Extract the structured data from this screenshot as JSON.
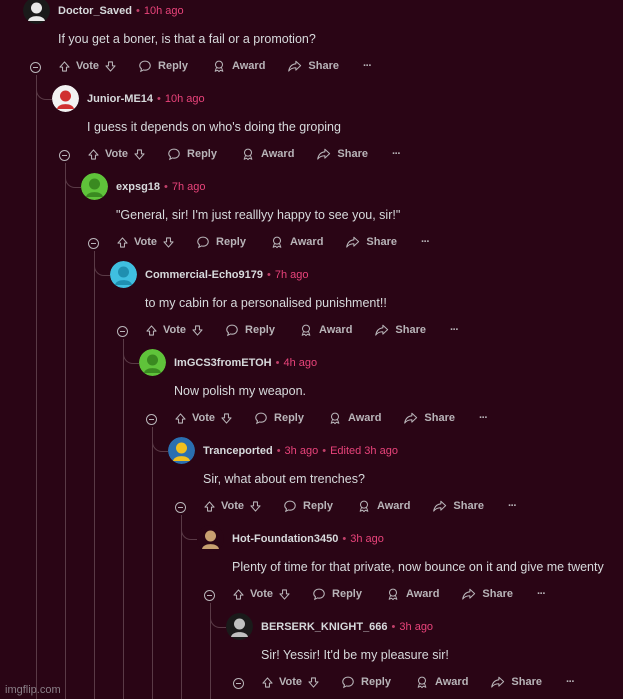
{
  "action_labels": {
    "vote": "Vote",
    "reply": "Reply",
    "award": "Award",
    "share": "Share",
    "more": "···"
  },
  "comments": [
    {
      "username": "Doctor_Saved",
      "time": "10h ago",
      "edited": "",
      "body": "If you get a boner, is that a fail or a promotion?",
      "avatar_color": "#1a1a1a",
      "avatar_fg": "#e8e8e8"
    },
    {
      "username": "Junior-ME14",
      "time": "10h ago",
      "edited": "",
      "body": "I guess it depends on who's doing the groping",
      "avatar_color": "#f2f2f2",
      "avatar_fg": "#d03030"
    },
    {
      "username": "expsg18",
      "time": "7h ago",
      "edited": "",
      "body": "\"General, sir! I'm just realllyy happy to see you, sir!\"",
      "avatar_color": "#5fc33a",
      "avatar_fg": "#3a8a20"
    },
    {
      "username": "Commercial-Echo9179",
      "time": "7h ago",
      "edited": "",
      "body": "to my cabin for a personalised punishment!!",
      "avatar_color": "#3fbfe0",
      "avatar_fg": "#1f8fb0"
    },
    {
      "username": "ImGCS3fromETOH",
      "time": "4h ago",
      "edited": "",
      "body": "Now polish my weapon.",
      "avatar_color": "#5fc33a",
      "avatar_fg": "#3a8a20"
    },
    {
      "username": "Tranceported",
      "time": "3h ago",
      "edited": "Edited 3h ago",
      "body": "Sir, what about em trenches?",
      "avatar_color": "#2a6fb0",
      "avatar_fg": "#f0c020"
    },
    {
      "username": "Hot-Foundation3450",
      "time": "3h ago",
      "edited": "",
      "body": "Plenty of time for that private, now bounce on it and give me twenty",
      "avatar_color": "#2a0515",
      "avatar_fg": "#c8a070"
    },
    {
      "username": "BERSERK_KNIGHT_666",
      "time": "3h ago",
      "edited": "",
      "body": "Sir! Yessir! It'd be my pleasure sir!",
      "avatar_color": "#1a1a1a",
      "avatar_fg": "#c0c0c0"
    }
  ],
  "watermark": "imgflip.com"
}
